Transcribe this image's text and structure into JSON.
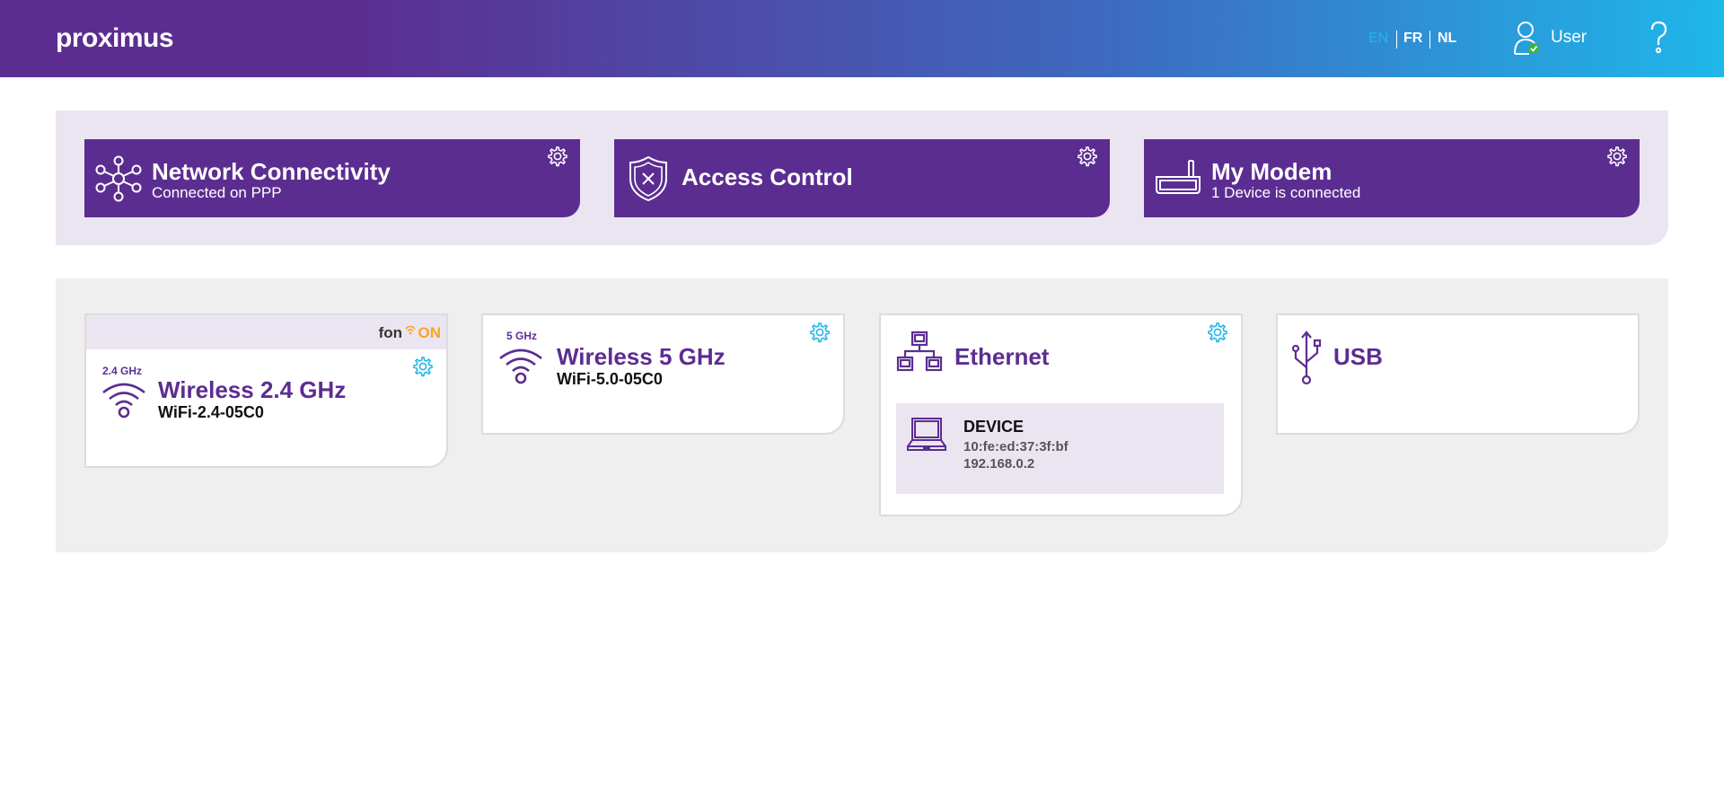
{
  "header": {
    "logo": "proximus",
    "languages": [
      "EN",
      "FR",
      "NL"
    ],
    "active_language": "EN",
    "user_label": "User",
    "icons": [
      "user-icon",
      "help-icon"
    ]
  },
  "colors": {
    "brand_purple": "#5c2d91",
    "accent_cyan": "#1fb7ea",
    "fon_orange": "#f5a623",
    "panel_lilac": "#ebe5f1",
    "panel_grey": "#efefef"
  },
  "top_cards": [
    {
      "title": "Network Connectivity",
      "subtitle": "Connected on PPP",
      "icon": "network-icon"
    },
    {
      "title": "Access Control",
      "subtitle": "",
      "icon": "shield-icon"
    },
    {
      "title": "My Modem",
      "subtitle": "1 Device is connected",
      "icon": "modem-icon"
    }
  ],
  "tiles": {
    "wifi24": {
      "band": "2.4 GHz",
      "title": "Wireless 2.4 GHz",
      "ssid": "WiFi-2.4-05C0",
      "fon_prefix": "fon",
      "fon_suffix": "ON"
    },
    "wifi5": {
      "band": "5 GHz",
      "title": "Wireless 5 GHz",
      "ssid": "WiFi-5.0-05C0"
    },
    "ethernet": {
      "title": "Ethernet",
      "device": {
        "name": "DEVICE",
        "mac": "10:fe:ed:37:3f:bf",
        "ip": "192.168.0.2"
      }
    },
    "usb": {
      "title": "USB"
    }
  }
}
